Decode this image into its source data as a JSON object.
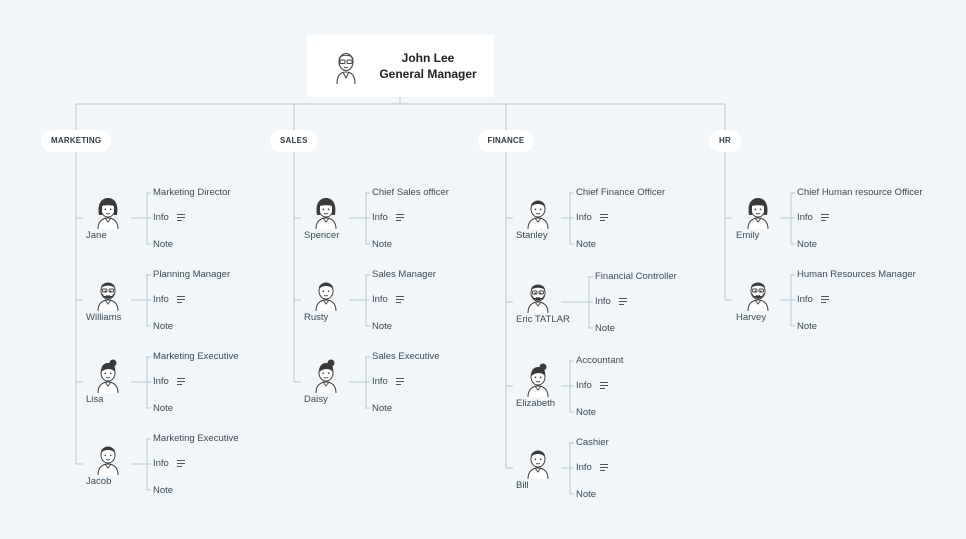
{
  "root": {
    "name": "John Lee",
    "title": "General Manager",
    "avatar": "glasses-man-avatar"
  },
  "departments": [
    {
      "label": "MARKETING",
      "people": [
        {
          "name": "Jane",
          "role": "Marketing Director",
          "avatar": "woman-bob-avatar"
        },
        {
          "name": "Williams",
          "role": "Planning Manager",
          "avatar": "bearded-glasses-avatar"
        },
        {
          "name": "Lisa",
          "role": "Marketing Executive",
          "avatar": "woman-bun-avatar"
        },
        {
          "name": "Jacob",
          "role": "Marketing Executive",
          "avatar": "man-avatar"
        }
      ]
    },
    {
      "label": "SALES",
      "people": [
        {
          "name": "Spencer",
          "role": "Chief Sales officer",
          "avatar": "woman-bob-avatar"
        },
        {
          "name": "Rusty",
          "role": "Sales Manager",
          "avatar": "man-avatar"
        },
        {
          "name": "Daisy",
          "role": "Sales Executive",
          "avatar": "woman-bun-avatar"
        }
      ]
    },
    {
      "label": "FINANCE",
      "people": [
        {
          "name": "Stanley",
          "role": "Chief Finance Officer",
          "avatar": "man-avatar"
        },
        {
          "name": "Eric TATLAR",
          "role": "Financial Controller",
          "avatar": "bearded-glasses-avatar"
        },
        {
          "name": "Elizabeth",
          "role": "Accountant",
          "avatar": "woman-bun-avatar"
        },
        {
          "name": "Bill",
          "role": "Cashier",
          "avatar": "man-avatar"
        }
      ]
    },
    {
      "label": "HR",
      "people": [
        {
          "name": "Emily",
          "role": "Chief Human resource Officer",
          "avatar": "woman-bob-avatar"
        },
        {
          "name": "Harvey",
          "role": "Human Resources Manager",
          "avatar": "bearded-glasses-avatar"
        }
      ]
    }
  ],
  "labels": {
    "info": "Info",
    "note": "Note"
  },
  "colors": {
    "background": "#f0f6f9",
    "connector": "#b9c7d1",
    "card": "#ffffff",
    "text": "#3f4a55"
  }
}
